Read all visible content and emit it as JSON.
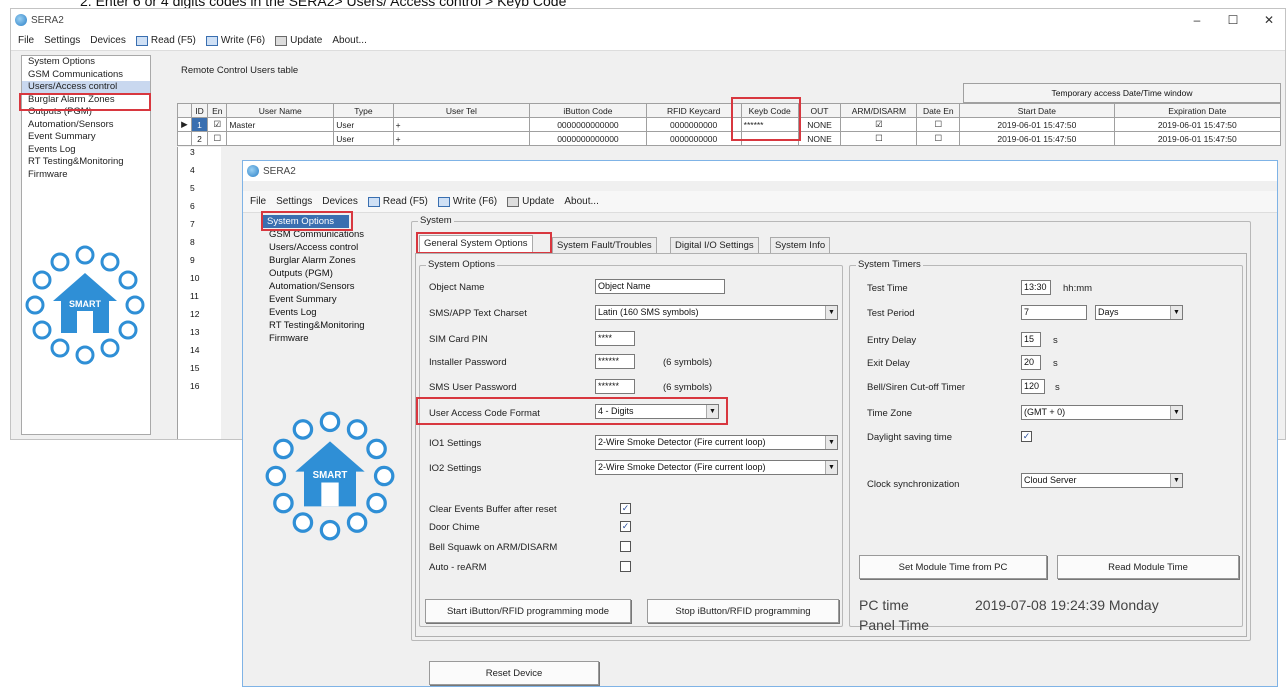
{
  "instruction": "2.     Enter 6 or 4 digits codes in the SERA2> Users/ Access control > Keyb Code",
  "back_window": {
    "title": "SERA2",
    "controls": {
      "minimize": "–",
      "maximize": "☐",
      "close": "✕"
    },
    "menu": [
      "File",
      "Settings",
      "Devices",
      "Read (F5)",
      "Write (F6)",
      "Update",
      "About..."
    ],
    "tree": [
      "System Options",
      "GSM Communications",
      "Users/Access control",
      "Burglar Alarm Zones",
      "Outputs (PGM)",
      "Automation/Sensors",
      "Event Summary",
      "Events Log",
      "RT Testing&Monitoring",
      "Firmware"
    ],
    "table_title": "Remote Control Users table",
    "temp_header": "Temporary access Date/Time window",
    "columns": [
      "ID",
      "En",
      "User Name",
      "Type",
      "User Tel",
      "iButton Code",
      "RFID Keycard",
      "Keyb Code",
      "OUT",
      "ARM/DISARM",
      "Date En",
      "Start Date",
      "Expiration Date"
    ],
    "rows": [
      {
        "id": "1",
        "en": "☑",
        "name": "Master",
        "type": "User",
        "tel": "+",
        "ibutton": "0000000000000",
        "rfid": "0000000000",
        "keyb": "******",
        "out": "NONE",
        "arm": "☑",
        "date_en": "☐",
        "start": "2019-06-01 15:47:50",
        "exp": "2019-06-01 15:47:50"
      },
      {
        "id": "2",
        "en": "☐",
        "name": "",
        "type": "User",
        "tel": "+",
        "ibutton": "0000000000000",
        "rfid": "0000000000",
        "keyb": "",
        "out": "NONE",
        "arm": "☐",
        "date_en": "☐",
        "start": "2019-06-01 15:47:50",
        "exp": "2019-06-01 15:47:50"
      }
    ],
    "row_ids": [
      "3",
      "4",
      "5",
      "6",
      "7",
      "8",
      "9",
      "10",
      "11",
      "12",
      "13",
      "14",
      "15",
      "16"
    ],
    "logo_text": "SMART"
  },
  "front_window": {
    "title": "SERA2",
    "menu": [
      "File",
      "Settings",
      "Devices",
      "Read (F5)",
      "Write (F6)",
      "Update",
      "About..."
    ],
    "tree": [
      "System Options",
      "GSM Communications",
      "Users/Access control",
      "Burglar Alarm Zones",
      "Outputs (PGM)",
      "Automation/Sensors",
      "Event Summary",
      "Events Log",
      "RT Testing&Monitoring",
      "Firmware"
    ],
    "system_group": "System",
    "tabs": [
      "General System Options",
      "System Fault/Troubles",
      "Digital I/O Settings",
      "System Info"
    ],
    "options_group": "System Options",
    "fields": {
      "object_name_label": "Object Name",
      "object_name_value": "Object Name",
      "sms_text_label": "SMS/APP Text Charset",
      "sms_text_value": "Latin (160 SMS symbols)",
      "sim_pin_label": "SIM Card PIN",
      "sim_pin_value": "****",
      "installer_pw_label": "Installer Password",
      "installer_pw_value": "******",
      "installer_pw_hint": "(6 symbols)",
      "sms_pw_label": "SMS User Password",
      "sms_pw_value": "******",
      "sms_pw_hint": "(6 symbols)",
      "uac_format_label": "User Access Code Format",
      "uac_format_value": "4 - Digits",
      "io1_label": "IO1 Settings",
      "io1_value": "2-Wire Smoke Detector (Fire current loop)",
      "io2_label": "IO2 Settings",
      "io2_value": "2-Wire Smoke Detector (Fire current loop)"
    },
    "checks": [
      {
        "label": "Clear Events Buffer after reset",
        "mark": "✓"
      },
      {
        "label": "Door Chime",
        "mark": "✓"
      },
      {
        "label": "Bell Squawk on ARM/DISARM",
        "mark": ""
      },
      {
        "label": "Auto - reARM",
        "mark": ""
      }
    ],
    "btn_start": "Start iButton/RFID programming mode",
    "btn_stop": "Stop iButton/RFID programming",
    "btn_reset": "Reset Device",
    "timers_group": "System Timers",
    "timers": {
      "test_time_label": "Test Time",
      "test_time_value": "13:30",
      "test_time_unit": "hh:mm",
      "test_period_label": "Test Period",
      "test_period_value": "7",
      "test_period_unit": "Days",
      "entry_delay_label": "Entry Delay",
      "entry_delay_value": "15",
      "entry_delay_unit": "s",
      "exit_delay_label": "Exit Delay",
      "exit_delay_value": "20",
      "exit_delay_unit": "s",
      "bell_label": "Bell/Siren Cut-off Timer",
      "bell_value": "120",
      "bell_unit": "s",
      "tz_label": "Time Zone",
      "tz_value": "(GMT + 0)",
      "dst_label": "Daylight saving time",
      "dst_mark": "✓",
      "clock_label": "Clock synchronization",
      "clock_value": "Cloud Server"
    },
    "btn_set_time": "Set Module Time from PC",
    "btn_read_time": "Read Module Time",
    "pc_time_label": "PC time",
    "pc_time_value": "2019-07-08 19:24:39 Monday",
    "panel_time_label": "Panel Time",
    "logo_text": "SMART"
  },
  "colors": {
    "highlight": "#d8373f",
    "accent": "#2a7fc6",
    "window_bg": "#f0f0f0"
  }
}
